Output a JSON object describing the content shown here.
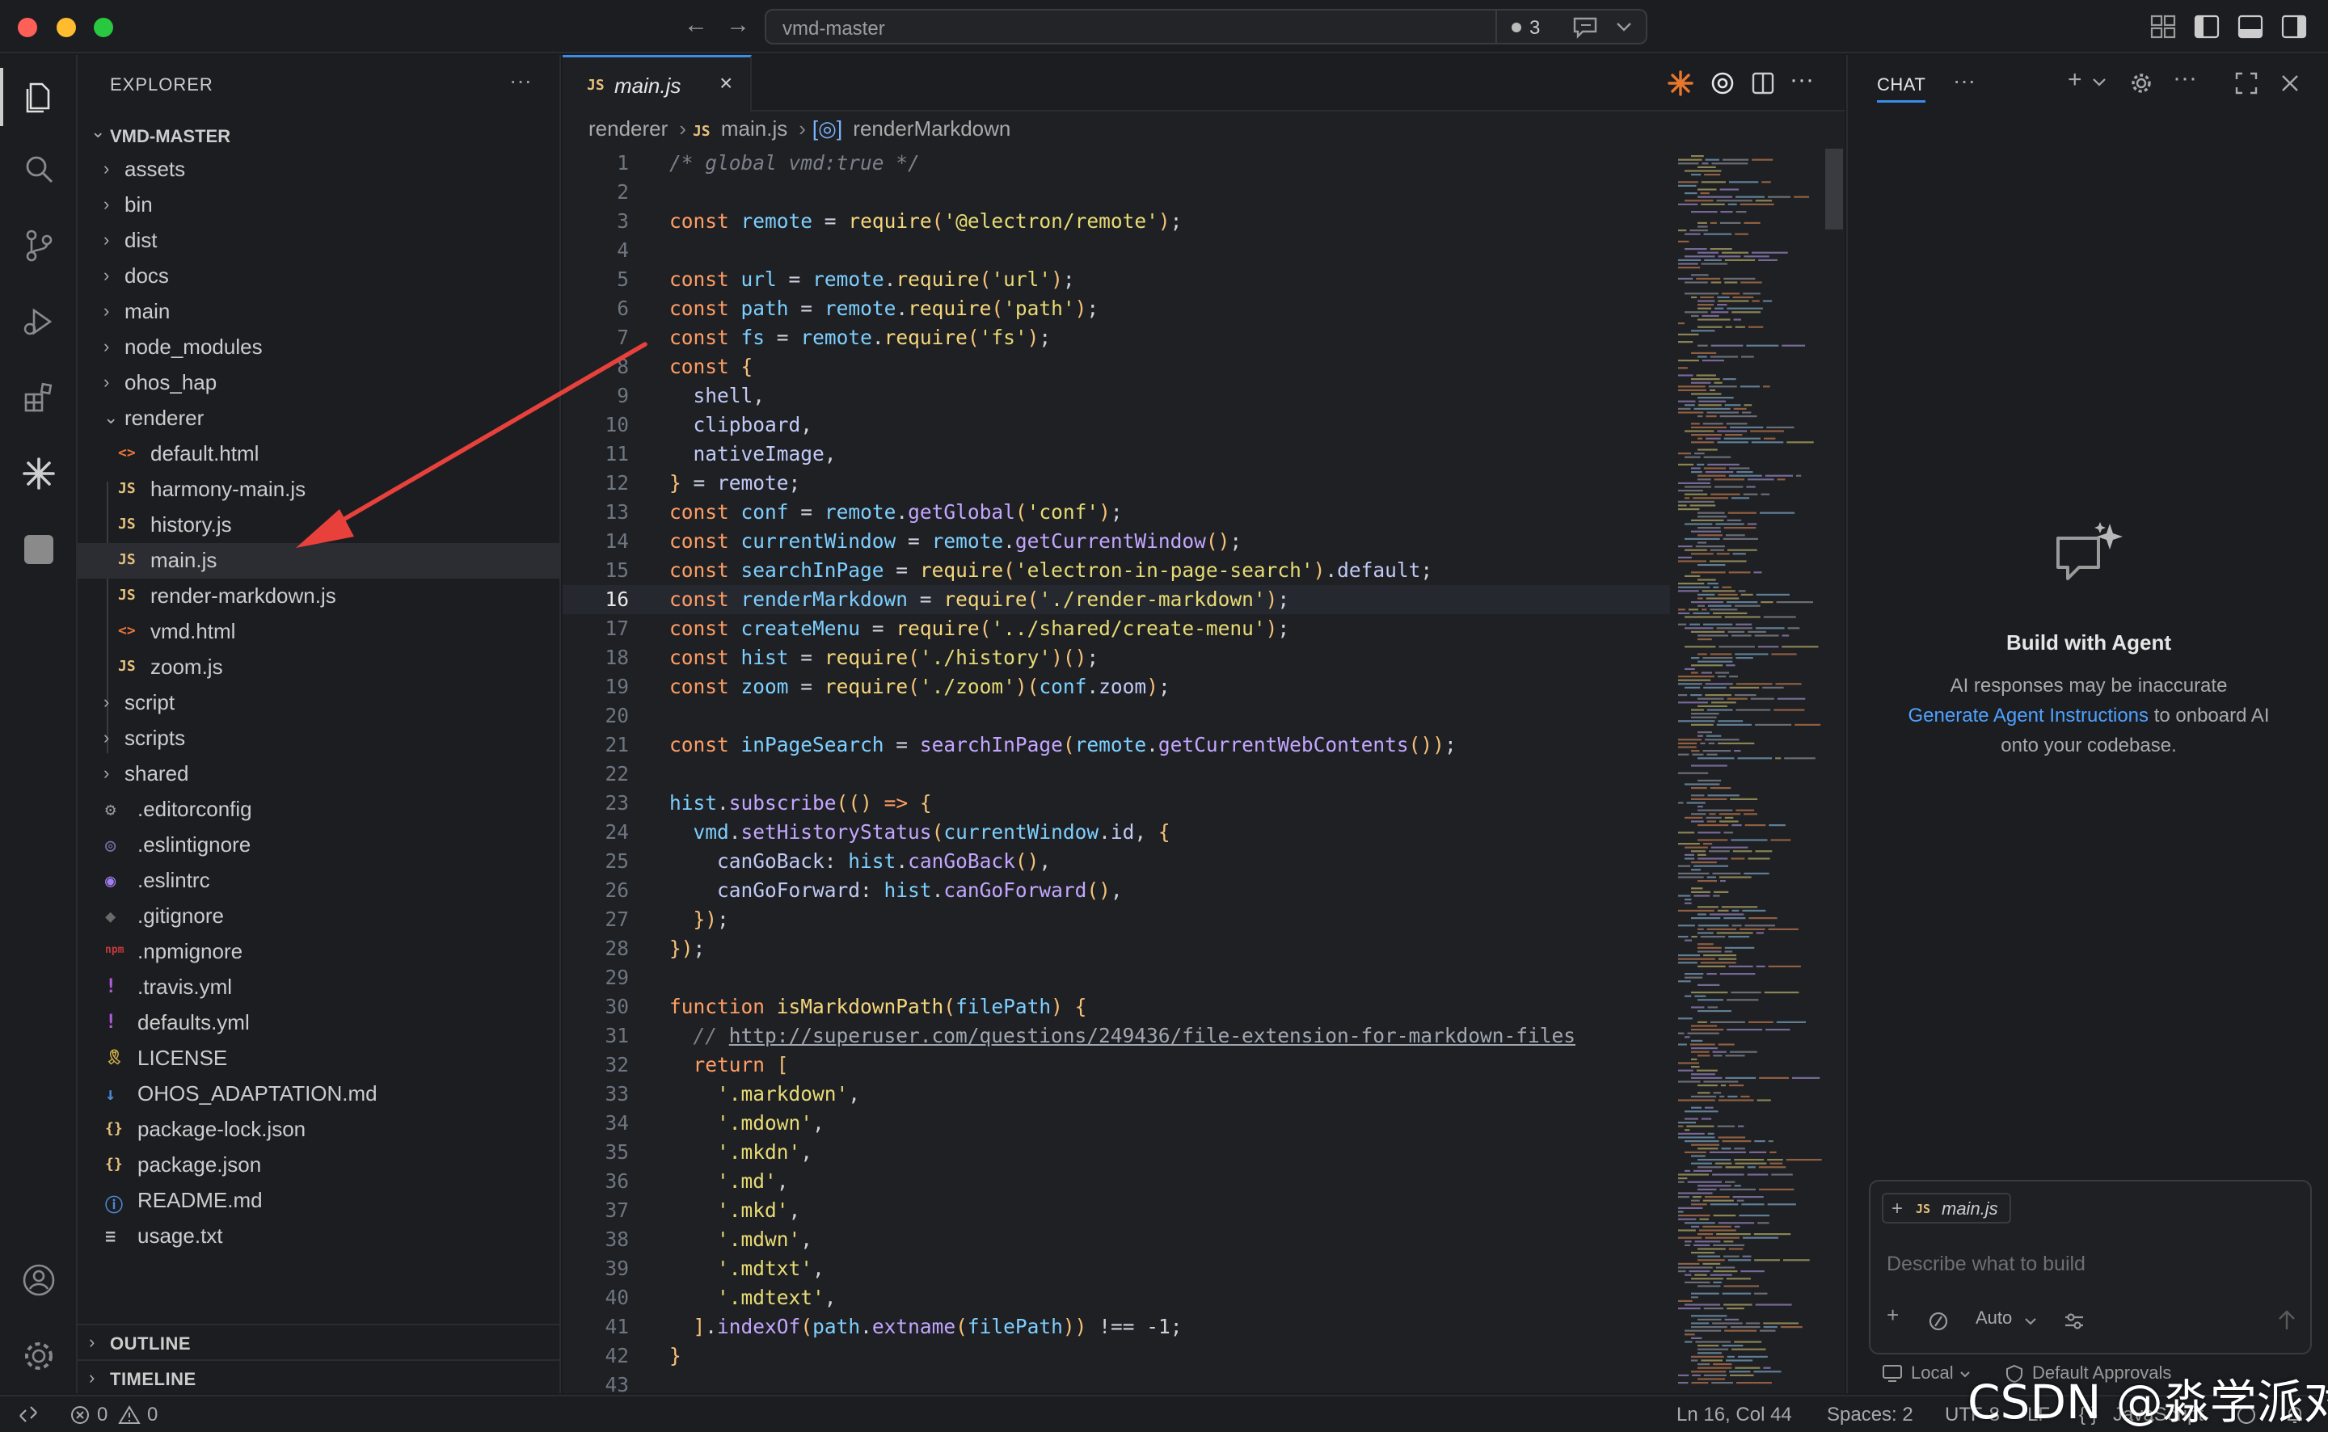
{
  "window": {
    "command_center": "vmd-master",
    "dirty_count": "3"
  },
  "sidebar": {
    "title": "EXPLORER",
    "more": "···",
    "root": "VMD-MASTER",
    "items": [
      {
        "label": "assets",
        "type": "folder",
        "depth": 0,
        "expanded": false
      },
      {
        "label": "bin",
        "type": "folder",
        "depth": 0,
        "expanded": false
      },
      {
        "label": "dist",
        "type": "folder",
        "depth": 0,
        "expanded": false
      },
      {
        "label": "docs",
        "type": "folder",
        "depth": 0,
        "expanded": false
      },
      {
        "label": "main",
        "type": "folder",
        "depth": 0,
        "expanded": false
      },
      {
        "label": "node_modules",
        "type": "folder",
        "depth": 0,
        "expanded": false
      },
      {
        "label": "ohos_hap",
        "type": "folder",
        "depth": 0,
        "expanded": false
      },
      {
        "label": "renderer",
        "type": "folder",
        "depth": 0,
        "expanded": true
      },
      {
        "label": "default.html",
        "type": "html",
        "depth": 1
      },
      {
        "label": "harmony-main.js",
        "type": "js",
        "depth": 1
      },
      {
        "label": "history.js",
        "type": "js",
        "depth": 1
      },
      {
        "label": "main.js",
        "type": "js",
        "depth": 1,
        "selected": true
      },
      {
        "label": "render-markdown.js",
        "type": "js",
        "depth": 1
      },
      {
        "label": "vmd.html",
        "type": "html",
        "depth": 1
      },
      {
        "label": "zoom.js",
        "type": "js",
        "depth": 1
      },
      {
        "label": "script",
        "type": "folder",
        "depth": 0,
        "expanded": false
      },
      {
        "label": "scripts",
        "type": "folder",
        "depth": 0,
        "expanded": false
      },
      {
        "label": "shared",
        "type": "folder",
        "depth": 0,
        "expanded": false
      },
      {
        "label": ".editorconfig",
        "type": "gear",
        "depth": 0
      },
      {
        "label": ".eslintignore",
        "type": "eslint-dim",
        "depth": 0
      },
      {
        "label": ".eslintrc",
        "type": "eslint",
        "depth": 0
      },
      {
        "label": ".gitignore",
        "type": "git",
        "depth": 0
      },
      {
        "label": ".npmignore",
        "type": "npm",
        "depth": 0
      },
      {
        "label": ".travis.yml",
        "type": "yml",
        "depth": 0
      },
      {
        "label": "defaults.yml",
        "type": "yml",
        "depth": 0
      },
      {
        "label": "LICENSE",
        "type": "license",
        "depth": 0
      },
      {
        "label": "OHOS_ADAPTATION.md",
        "type": "md",
        "depth": 0
      },
      {
        "label": "package-lock.json",
        "type": "json",
        "depth": 0
      },
      {
        "label": "package.json",
        "type": "json",
        "depth": 0
      },
      {
        "label": "README.md",
        "type": "info",
        "depth": 0
      },
      {
        "label": "usage.txt",
        "type": "txt",
        "depth": 0
      }
    ],
    "outline": "OUTLINE",
    "timeline": "TIMELINE"
  },
  "editor": {
    "tab": {
      "badge": "JS",
      "label": "main.js",
      "close": "×"
    },
    "breadcrumb": [
      "renderer",
      "main.js",
      "renderMarkdown"
    ],
    "current_line": 16,
    "lines": [
      "/* global vmd:true */",
      "",
      "const remote = require('@electron/remote');",
      "",
      "const url = remote.require('url');",
      "const path = remote.require('path');",
      "const fs = remote.require('fs');",
      "const {",
      "  shell,",
      "  clipboard,",
      "  nativeImage,",
      "} = remote;",
      "const conf = remote.getGlobal('conf');",
      "const currentWindow = remote.getCurrentWindow();",
      "const searchInPage = require('electron-in-page-search').default;",
      "const renderMarkdown = require('./render-markdown');",
      "const createMenu = require('../shared/create-menu');",
      "const hist = require('./history')();",
      "const zoom = require('./zoom')(conf.zoom);",
      "",
      "const inPageSearch = searchInPage(remote.getCurrentWebContents());",
      "",
      "hist.subscribe(() => {",
      "  vmd.setHistoryStatus(currentWindow.id, {",
      "    canGoBack: hist.canGoBack(),",
      "    canGoForward: hist.canGoForward(),",
      "  });",
      "});",
      "",
      "function isMarkdownPath(filePath) {",
      "  // http://superuser.com/questions/249436/file-extension-for-markdown-files",
      "  return [",
      "    '.markdown',",
      "    '.mdown',",
      "    '.mkdn',",
      "    '.md',",
      "    '.mkd',",
      "    '.mdwn',",
      "    '.mdtxt',",
      "    '.mdtext',",
      "  ].indexOf(path.extname(filePath)) !== -1;",
      "}",
      ""
    ]
  },
  "chat": {
    "tab": "CHAT",
    "more": "···",
    "title": "Build with Agent",
    "line1": "AI responses may be inaccurate",
    "link": "Generate Agent Instructions",
    "line2_rest": " to onboard AI",
    "line3": "onto your codebase.",
    "context_file": "main.js",
    "context_badge": "JS",
    "placeholder": "Describe what to build",
    "mode": "Auto",
    "footer_local": "Local",
    "footer_approvals": "Default Approvals"
  },
  "status": {
    "errors": "0",
    "warnings": "0",
    "position": "Ln 16, Col 44",
    "spaces": "Spaces: 2",
    "encoding": "UTF-8",
    "eol": "LF",
    "language": "JavaScript"
  },
  "watermark": "CSDN @淼学派对",
  "colors": {
    "accent": "#3a8ee6",
    "arrow": "#e8413c",
    "link": "#4ea1ff"
  }
}
